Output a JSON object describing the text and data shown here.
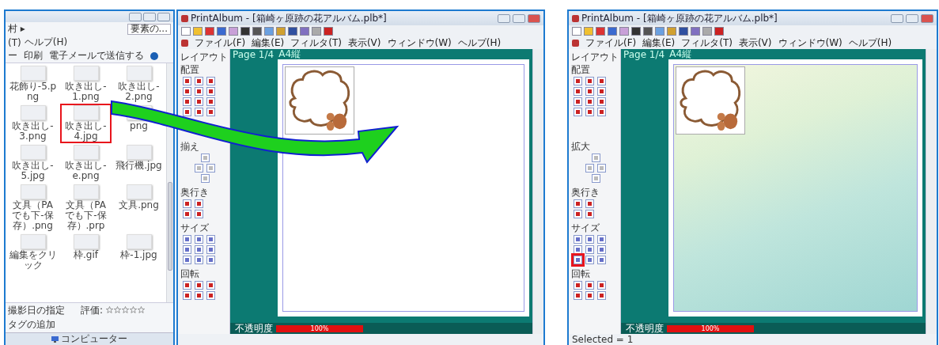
{
  "explorer": {
    "address": "村 ▸",
    "search": "要素の...",
    "menu": [
      "(T)",
      "ヘルプ(H)"
    ],
    "toolbar": [
      "ー",
      "印刷",
      "電子メールで送信する"
    ],
    "files": [
      {
        "name": "花飾り-5.png",
        "selected": false
      },
      {
        "name": "吹き出し-1.png",
        "selected": false
      },
      {
        "name": "吹き出し-2.png",
        "selected": false
      },
      {
        "name": "吹き出し-3.png",
        "selected": false
      },
      {
        "name": "吹き出し-4.jpg",
        "selected": true
      },
      {
        "name": "png",
        "selected": false
      },
      {
        "name": "吹き出し-5.jpg",
        "selected": false
      },
      {
        "name": "吹き出し-e.png",
        "selected": false
      },
      {
        "name": "飛行機.jpg",
        "selected": false
      },
      {
        "name": "文具（PAでも下-保存）.png",
        "selected": false
      },
      {
        "name": "文具（PAでも下-保存）.prp",
        "selected": false
      },
      {
        "name": "文具.png",
        "selected": false
      },
      {
        "name": "編集をクリック",
        "selected": false
      },
      {
        "name": "枠.gif",
        "selected": false
      },
      {
        "name": "枠-1.jpg",
        "selected": false
      }
    ],
    "details": [
      "撮影日の指定",
      "タグの追加"
    ],
    "rating_label": "評価:",
    "stars": 0,
    "footer": "コンピューター"
  },
  "windows": [
    {
      "title": "PrintAlbum - [箱崎ヶ原跡の花アルバム.plb*]",
      "menu": [
        "ファイル(F)",
        "編集(E)",
        "フィルタ(T)",
        "表示(V)",
        "ウィンドウ(W)",
        "ヘルプ(H)"
      ],
      "panel_title": "レイアウト",
      "sections": [
        "配置",
        "揃え",
        "奥行き",
        "サイズ",
        "回転"
      ],
      "page_tabs": [
        "Page 1/4",
        "A4縦"
      ],
      "opacity_label": "不透明度",
      "opacity_value": "100%",
      "patterned_background": false,
      "tool_highlighted": false
    },
    {
      "title": "PrintAlbum - [箱崎ヶ原跡の花アルバム.plb*]",
      "menu": [
        "ファイル(F)",
        "編集(E)",
        "フィルタ(T)",
        "表示(V)",
        "ウィンドウ(W)",
        "ヘルプ(H)"
      ],
      "panel_title": "レイアウト",
      "sections": [
        "配置",
        "拡大",
        "奥行き",
        "サイズ",
        "回転"
      ],
      "page_tabs": [
        "Page 1/4",
        "A4縦"
      ],
      "opacity_label": "不透明度",
      "opacity_value": "100%",
      "patterned_background": true,
      "tool_highlighted": true,
      "status": "Selected = 1"
    }
  ]
}
